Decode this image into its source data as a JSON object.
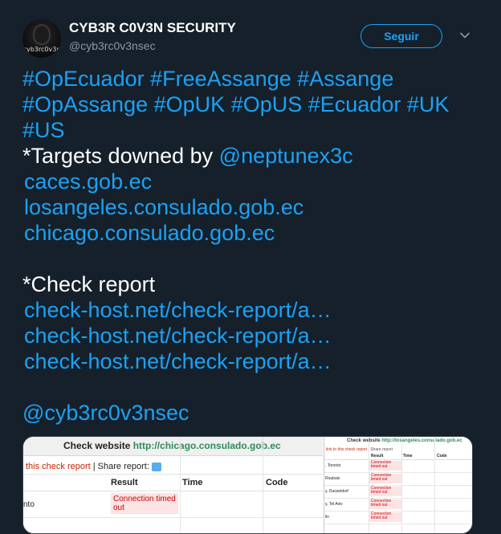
{
  "user": {
    "name": "CYB3R C0V3N SECURITY",
    "handle": "@cyb3rc0v3nsec",
    "avatar_text": "cyb3rc0v3n"
  },
  "follow_label": "Seguir",
  "tweet": {
    "hashtags_line1": [
      "#OpEcuador",
      "#FreeAssange",
      "#Assange"
    ],
    "hashtags_line2": [
      "#OpAssange",
      "#OpUK",
      "#OpUS",
      "#Ecuador",
      "#UK"
    ],
    "hashtags_line3": [
      "#US"
    ],
    "targets_prefix": "*Targets downed by ",
    "targets_mention": "@neptunex3c",
    "targets": [
      "caces.gob.ec",
      "losangeles.consulado.gob.ec",
      "chicago.consulado.gob.ec"
    ],
    "check_report_label": "*Check report",
    "check_links": [
      "check-host.net/check-report/a…",
      "check-host.net/check-report/a…",
      "check-host.net/check-report/a…"
    ],
    "final_mention": "@cyb3rc0v3nsec"
  },
  "media": {
    "left": {
      "title_prefix": "Check website",
      "title_url": "http://chicago.consulado.gob.ec",
      "sub_link": "this check report",
      "sub_rest": " | Share report:",
      "columns": [
        "Result",
        "Time",
        "Code"
      ],
      "row_location": "nto",
      "row_result": "Connection timed out"
    },
    "right": {
      "title_prefix": "Check website",
      "title_url": "http://losangeles.consulado.gob.ec",
      "sub_link": "link to this check report",
      "sub_rest": " | Share report",
      "columns": [
        "Result",
        "Time",
        "Code"
      ],
      "rows": [
        {
          "location": ", Toronto",
          "result": "Connection timed out"
        },
        {
          "location": "Roubaix",
          "result": "Connection timed out"
        },
        {
          "location": "y, Dusseldorf",
          "result": "Connection timed out"
        },
        {
          "location": "y, Tel Aviv",
          "result": "Connection timed out"
        },
        {
          "location": "lin",
          "result": "Connection timed out"
        }
      ]
    }
  },
  "colors": {
    "background": "#15202b",
    "accent": "#1da1f2",
    "secondary_text": "#8899a6"
  }
}
